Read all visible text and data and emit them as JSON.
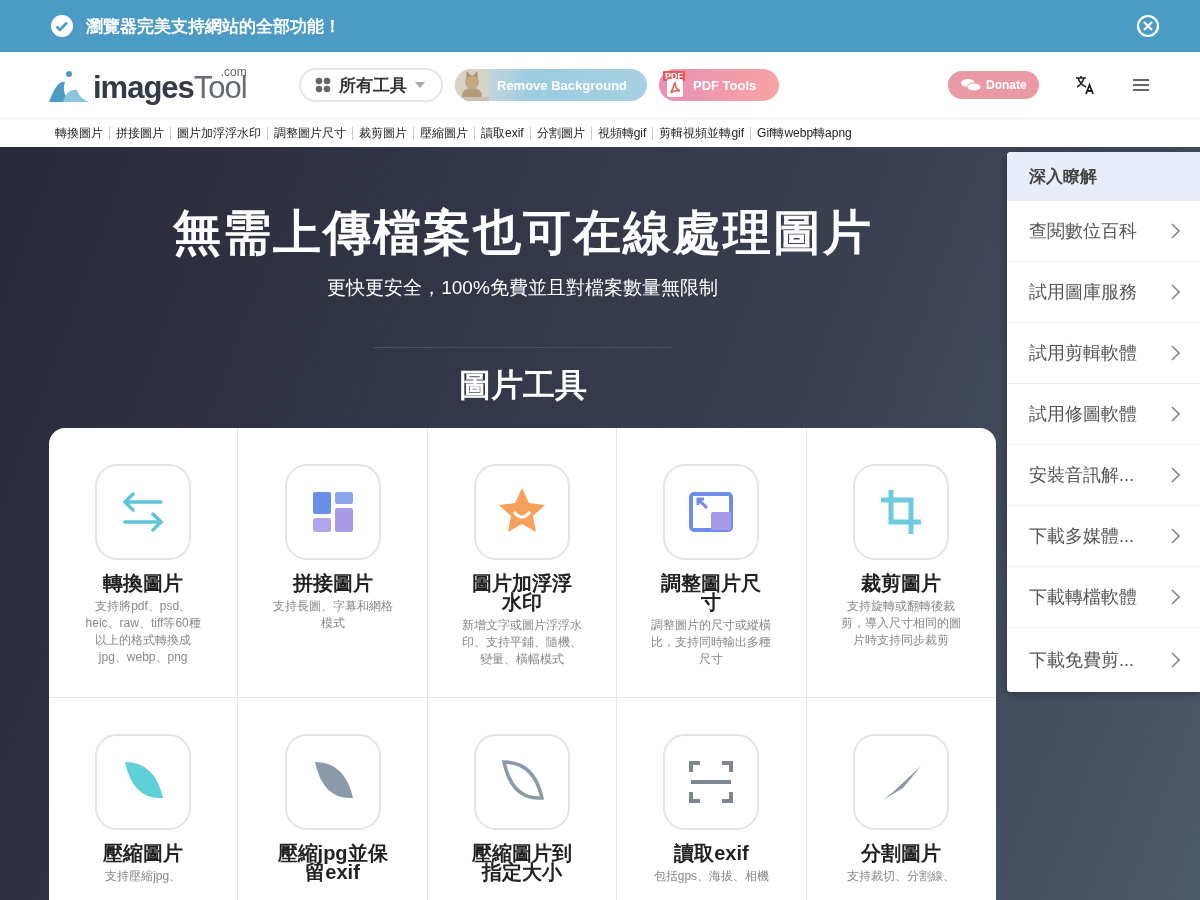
{
  "banner": {
    "message": "瀏覽器完美支持網站的全部功能！"
  },
  "header": {
    "logo": {
      "name": "images",
      "accent": "Tool",
      "tld": ".com"
    },
    "tools_menu": {
      "label": "所有工具"
    },
    "remove_background": "Remove Background",
    "pdf_tools": {
      "label": "PDF Tools",
      "badge": "PDF"
    },
    "donate": "Donate"
  },
  "nav_links": [
    "轉換圖片",
    "拼接圖片",
    "圖片加浮浮水印",
    "調整圖片尺寸",
    "裁剪圖片",
    "壓縮圖片",
    "讀取exif",
    "分割圖片",
    "視頻轉gif",
    "剪輯視頻並轉gif",
    "Gif轉webp轉apng"
  ],
  "hero": {
    "title": "無需上傳檔案也可在線處理圖片",
    "subtitle": "更快更安全，100%免費並且對檔案數量無限制",
    "section_title": "圖片工具"
  },
  "tools": [
    {
      "name": "轉換圖片",
      "description": "支持將pdf、psd、heic、raw、tiff等60種以上的格式轉換成jpg、webp、png"
    },
    {
      "name": "拼接圖片",
      "description": "支持長圖、字幕和網格模式"
    },
    {
      "name": "圖片加浮浮水印",
      "description": "新增文字或圖片浮浮水印、支持平鋪、隨機、變量、橫幅模式"
    },
    {
      "name": "調整圖片尺寸",
      "description": "調整圖片的尺寸或縱橫比，支持同時輸出多種尺寸"
    },
    {
      "name": "裁剪圖片",
      "description": "支持旋轉或翻轉後裁剪，導入尺寸相同的圖片時支持同步裁剪"
    },
    {
      "name": "壓縮圖片",
      "description": "支持壓縮jpg、"
    },
    {
      "name": "壓縮jpg並保留exif"
    },
    {
      "name": "壓縮圖片到指定大小"
    },
    {
      "name": "讀取exif",
      "description": "包括gps、海拔、相機"
    },
    {
      "name": "分割圖片",
      "description": "支持裁切、分割線、"
    }
  ],
  "side_menu": {
    "title": "深入瞭解",
    "items": [
      "查閱數位百科",
      "試用圖庫服務",
      "試用剪輯軟體",
      "試用修圖軟體",
      "安裝音訊解...",
      "下載多媒體...",
      "下載轉檔軟體",
      "下載免費剪..."
    ]
  }
}
